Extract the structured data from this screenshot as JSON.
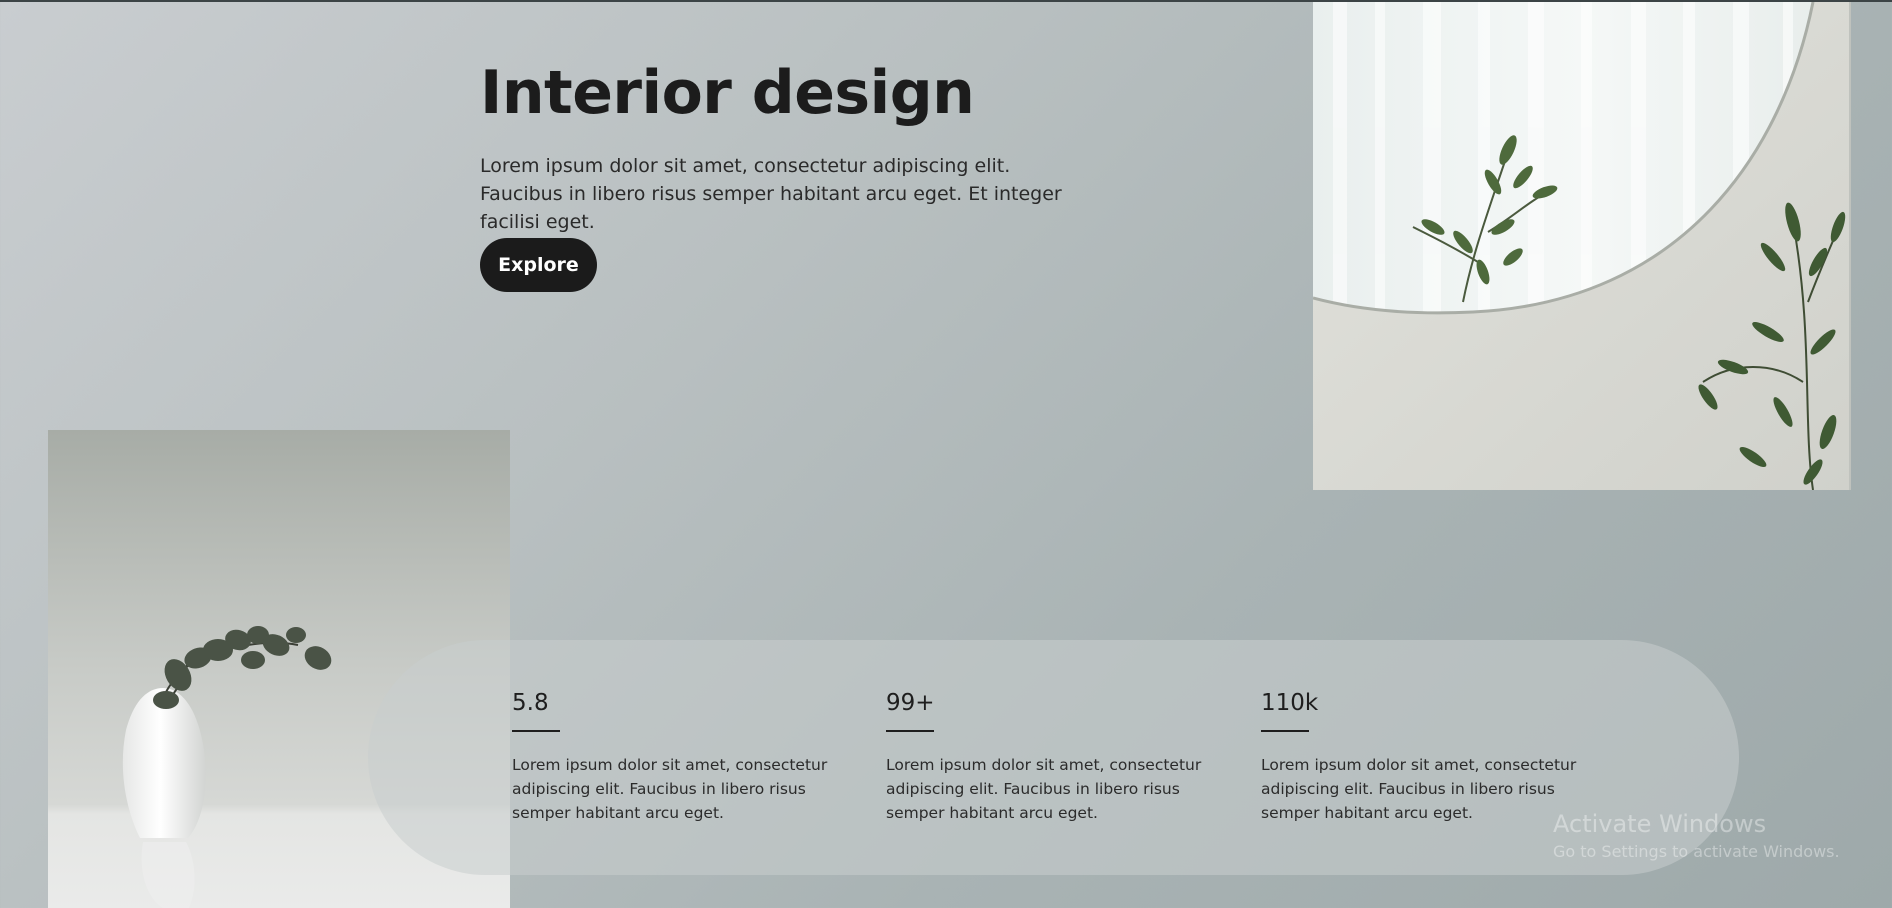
{
  "hero": {
    "title": "Interior design",
    "description": "Lorem ipsum dolor sit amet, consectetur adipiscing elit. Faucibus in libero risus semper habitant arcu eget. Et integer facilisi eget.",
    "button_label": "Explore"
  },
  "images": {
    "mirror_photo": "mirror-with-olive-branch-photo",
    "vase_photo": "white-vase-with-eucalyptus-photo"
  },
  "stats": [
    {
      "value": "5.8",
      "description": "Lorem ipsum dolor sit amet, consectetur adipiscing elit. Faucibus in libero risus semper habitant arcu eget."
    },
    {
      "value": "99+",
      "description": "Lorem ipsum dolor sit amet, consectetur adipiscing elit. Faucibus in libero risus semper habitant arcu eget."
    },
    {
      "value": "110k",
      "description": "Lorem ipsum dolor sit amet, consectetur adipiscing elit. Faucibus in libero risus semper habitant arcu eget."
    }
  ],
  "watermark": {
    "title": "Activate Windows",
    "subtitle": "Go to Settings to activate Windows."
  },
  "colors": {
    "button_bg": "#1b1b1b",
    "text_dark": "#1e1e1e"
  }
}
